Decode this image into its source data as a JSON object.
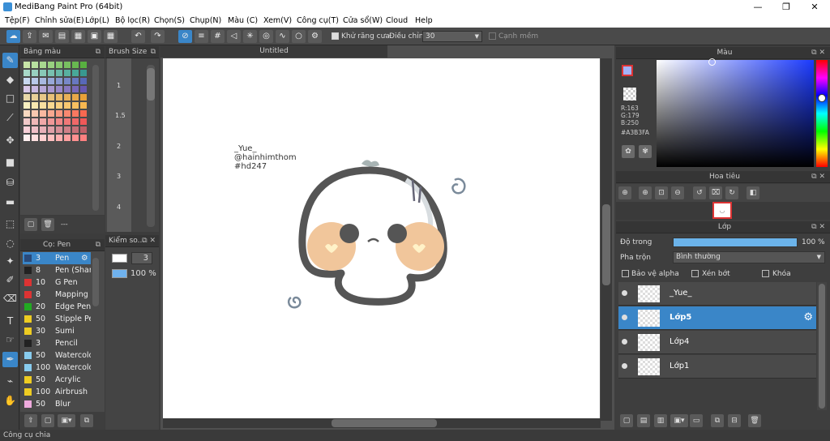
{
  "window": {
    "title": "MediBang Paint Pro (64bit)",
    "min": "—",
    "max": "❐",
    "close": "✕"
  },
  "menu": [
    "Tệp(F)",
    "Chỉnh sửa(E)",
    "Lớp(L)",
    "Bộ lọc(R)",
    "Chọn(S)",
    "Chụp(N)",
    "Màu (C)",
    "Xem(V)",
    "Công cụ(T)",
    "Cửa sổ(W)",
    "Cloud",
    "Help"
  ],
  "toolbar": {
    "antialias_label": "Khử răng cưa",
    "adjust_label": "Điều chỉnh",
    "adjust_value": "30",
    "edge_label": "Cạnh mềm"
  },
  "palette_panel": {
    "title": "Bảng màu",
    "footer": "---"
  },
  "brushsize_panel": {
    "title": "Brush Size",
    "sizes": [
      "1",
      "1.5",
      "2",
      "3",
      "4"
    ]
  },
  "brush_panel": {
    "title": "Cọ: Pen",
    "items": [
      {
        "size": "3",
        "name": "Pen",
        "color": "#2a4a7a"
      },
      {
        "size": "8",
        "name": "Pen (Sharp)",
        "color": "#222222"
      },
      {
        "size": "10",
        "name": "G Pen",
        "color": "#dd3333"
      },
      {
        "size": "8",
        "name": "Mapping Pen",
        "color": "#dd3333"
      },
      {
        "size": "20",
        "name": "Edge Pen",
        "color": "#22aa22"
      },
      {
        "size": "50",
        "name": "Stipple Pen",
        "color": "#eecc22"
      },
      {
        "size": "30",
        "name": "Sumi",
        "color": "#eecc22"
      },
      {
        "size": "3",
        "name": "Pencil",
        "color": "#222222"
      },
      {
        "size": "50",
        "name": "Watercolor",
        "color": "#88ccee"
      },
      {
        "size": "100",
        "name": "Watercolor",
        "color": "#88ccee"
      },
      {
        "size": "50",
        "name": "Acrylic",
        "color": "#eecc22"
      },
      {
        "size": "100",
        "name": "Airbrush",
        "color": "#eecc22"
      },
      {
        "size": "50",
        "name": "Blur",
        "color": "#eeaadd"
      }
    ]
  },
  "stroke_panel": {
    "title": "Kiểm so...",
    "width": "3",
    "opacity": "100 %"
  },
  "canvas": {
    "tab": "Untitled",
    "text_line1": "_Yue_",
    "text_line2": "@hainhimthom",
    "text_line3": "#hd247"
  },
  "color_panel": {
    "title": "Màu",
    "r": "R:163",
    "g": "G:179",
    "b": "B:250",
    "hex": "#A3B3FA",
    "current": "#A3B3FA"
  },
  "nav_panel": {
    "title": "Hoa tiêu"
  },
  "layer_panel": {
    "title": "Lớp",
    "opacity_label": "Độ trong",
    "opacity_value": "100 %",
    "blend_label": "Pha trộn",
    "blend_value": "Bình thường",
    "protect_alpha": "Bảo vệ alpha",
    "clipping": "Xén bớt",
    "lock": "Khóa",
    "layers": [
      "_Yue_",
      "Lớp5",
      "Lớp4",
      "Lớp1"
    ]
  },
  "status": "Công cụ chia"
}
